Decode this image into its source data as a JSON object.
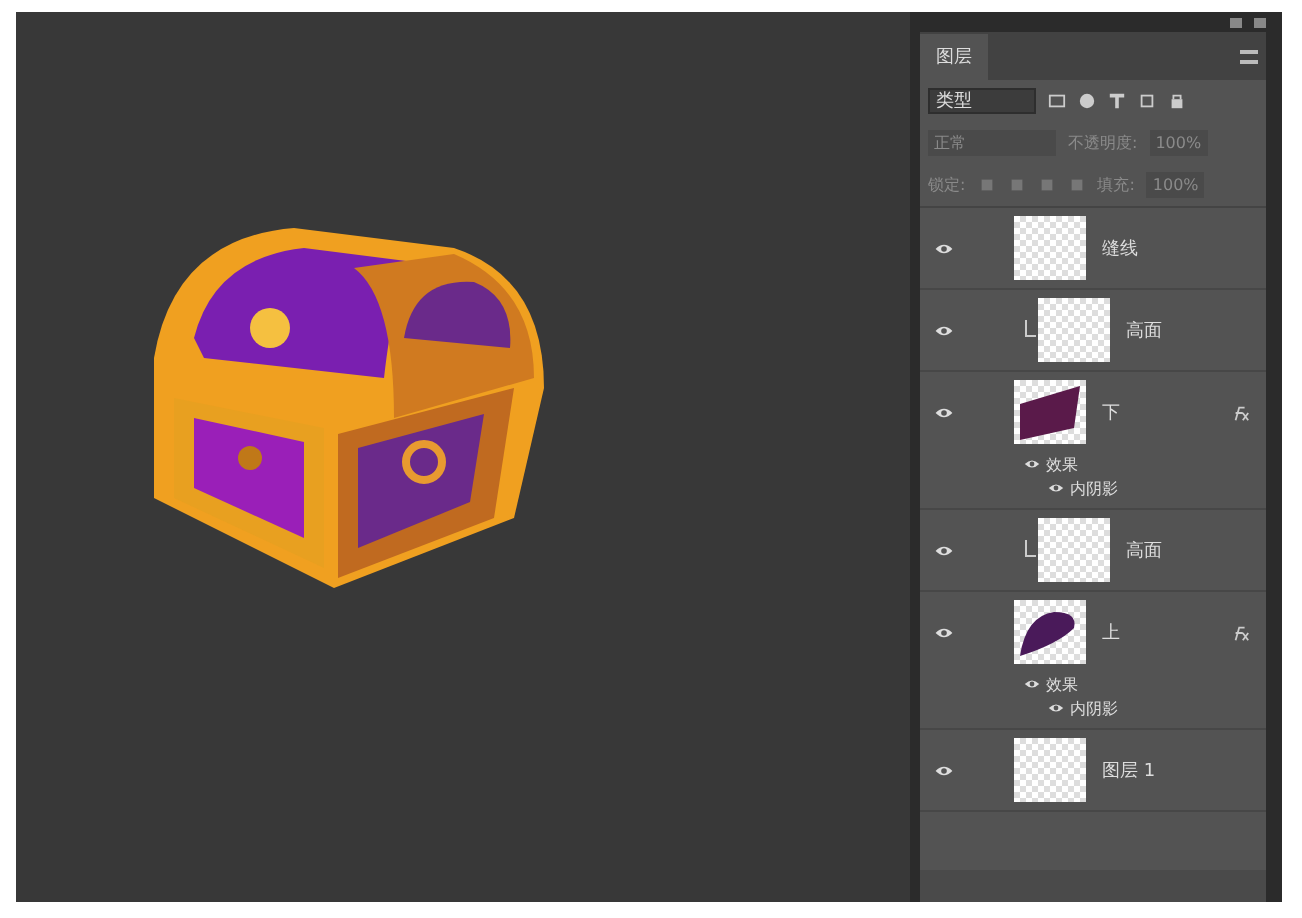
{
  "panel": {
    "tab": "图层",
    "filter": "类型",
    "blend_mode": "正常",
    "opacity_label": "不透明度:",
    "opacity": "100%",
    "lock_label": "锁定:",
    "fill_label": "填充:",
    "fill": "100%"
  },
  "layers": [
    {
      "name": "缝线",
      "visible": true,
      "clipped": false,
      "kind": "blank",
      "fx": false
    },
    {
      "name": "高面",
      "visible": true,
      "clipped": true,
      "kind": "blank",
      "fx": false
    },
    {
      "name": "下",
      "visible": true,
      "clipped": false,
      "kind": "slab",
      "fx": true,
      "effects": [
        {
          "label": "效果",
          "visible": true
        },
        {
          "label": "内阴影",
          "visible": true
        }
      ]
    },
    {
      "name": "高面",
      "visible": true,
      "clipped": true,
      "kind": "blank",
      "fx": false
    },
    {
      "name": "上",
      "visible": true,
      "clipped": false,
      "kind": "lid",
      "fx": true,
      "effects": [
        {
          "label": "效果",
          "visible": true
        },
        {
          "label": "内阴影",
          "visible": true
        }
      ]
    },
    {
      "name": "图层 1",
      "visible": true,
      "clipped": false,
      "kind": "blank",
      "fx": false
    }
  ]
}
